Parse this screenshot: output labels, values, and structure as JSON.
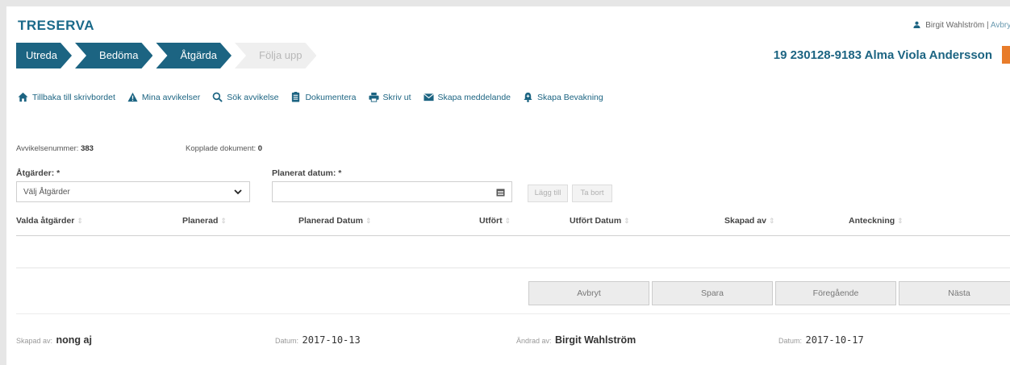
{
  "app": {
    "brand": "TRESERVA"
  },
  "user": {
    "name": "Birgit Wahlström",
    "separator": " | ",
    "cancel_link": "Avbryt"
  },
  "steps": [
    {
      "label": "Utreda",
      "active": true
    },
    {
      "label": "Bedöma",
      "active": true
    },
    {
      "label": "Åtgärda",
      "active": true
    },
    {
      "label": "Följa upp",
      "active": false
    }
  ],
  "patient": {
    "label": "19 230128-9183 Alma Viola Andersson"
  },
  "toolbar": {
    "items": [
      {
        "label": "Tillbaka till skrivbordet",
        "icon": "home-icon"
      },
      {
        "label": "Mina avvikelser",
        "icon": "warning-icon"
      },
      {
        "label": "Sök avvikelse",
        "icon": "search-icon"
      },
      {
        "label": "Dokumentera",
        "icon": "document-icon"
      },
      {
        "label": "Skriv ut",
        "icon": "printer-icon"
      },
      {
        "label": "Skapa meddelande",
        "icon": "envelope-icon"
      },
      {
        "label": "Skapa Bevakning",
        "icon": "bell-icon"
      }
    ]
  },
  "meta": {
    "deviation_number_label": "Avvikelsenummer:",
    "deviation_number_value": "383",
    "linked_docs_label": "Kopplade dokument:",
    "linked_docs_value": "0"
  },
  "form": {
    "actions_label": "Åtgärder: *",
    "actions_select_value": "Välj Åtgärder",
    "planned_date_label": "Planerat datum: *",
    "planned_date_value": "",
    "add_button": "Lägg till",
    "remove_button": "Ta bort"
  },
  "table": {
    "columns": [
      "Valda åtgärder",
      "Planerad",
      "Planerad Datum",
      "Utfört",
      "Utfört Datum",
      "Skapad av",
      "Anteckning"
    ],
    "sort_glyph": "⇕",
    "rows": []
  },
  "actions": {
    "cancel": "Avbryt",
    "save": "Spara",
    "previous": "Föregående",
    "next": "Nästa"
  },
  "footer": {
    "created_by_label": "Skapad av:",
    "created_by_value": "nong aj",
    "created_date_label": "Datum:",
    "created_date_value": "2017-10-13",
    "changed_by_label": "Ändrad av:",
    "changed_by_value": "Birgit Wahlström",
    "changed_date_label": "Datum:",
    "changed_date_value": "2017-10-17"
  },
  "colors": {
    "primary": "#1c6482",
    "accent": "#e87c2a",
    "step_inactive": "#efefef"
  }
}
